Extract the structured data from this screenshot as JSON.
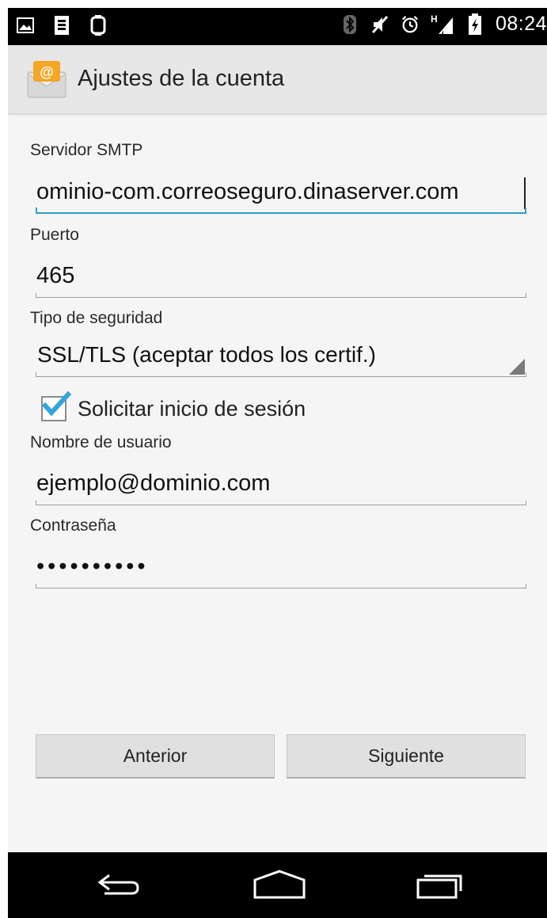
{
  "status_bar": {
    "time": "08:24",
    "network_indicator": "H",
    "left_icons": [
      "image-icon",
      "sim-icon",
      "watch-icon"
    ],
    "right_icons": [
      "bluetooth-icon",
      "mute-icon",
      "alarm-icon",
      "signal-icon",
      "battery-icon"
    ]
  },
  "action_bar": {
    "title": "Ajustes de la cuenta",
    "icon": "email-app-icon"
  },
  "form": {
    "smtp_label": "Servidor SMTP",
    "smtp_value": "ominio-com.correoseguro.dinaserver.com",
    "port_label": "Puerto",
    "port_value": "465",
    "security_label": "Tipo de seguridad",
    "security_value": "SSL/TLS (aceptar todos los certif.)",
    "require_login_label": "Solicitar inicio de sesión",
    "require_login_checked": true,
    "username_label": "Nombre de usuario",
    "username_value": "ejemplo@dominio.com",
    "password_label": "Contraseña",
    "password_value": "••••••••••"
  },
  "buttons": {
    "previous": "Anterior",
    "next": "Siguiente"
  },
  "nav_bar": {
    "icons": [
      "back-icon",
      "home-icon",
      "recents-icon"
    ]
  },
  "colors": {
    "accent": "#2e9dc9",
    "checkbox_blue": "#33a3dc",
    "action_bar_bg": "#e7e7e7",
    "background": "#f5f5f5"
  }
}
